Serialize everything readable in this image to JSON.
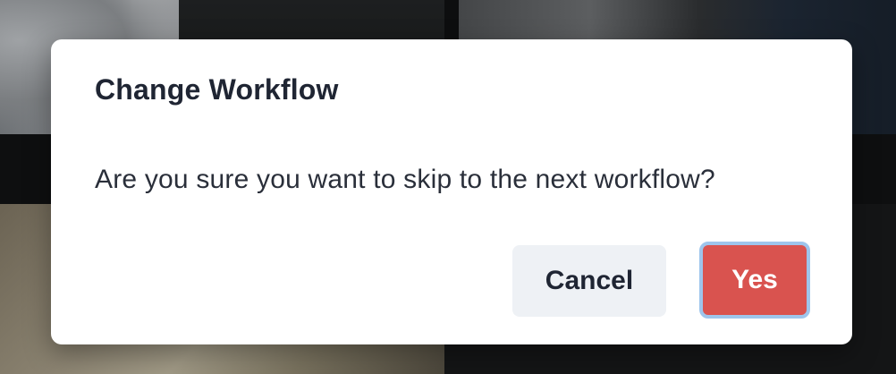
{
  "dialog": {
    "title": "Change Workflow",
    "message": "Are you sure you want to skip to the next workflow?",
    "cancel_label": "Cancel",
    "confirm_label": "Yes"
  },
  "colors": {
    "confirm_button": "#d9534f",
    "confirm_focus_ring": "#9ec5ec",
    "cancel_button": "#eef1f5",
    "title_text": "#1f2533"
  }
}
